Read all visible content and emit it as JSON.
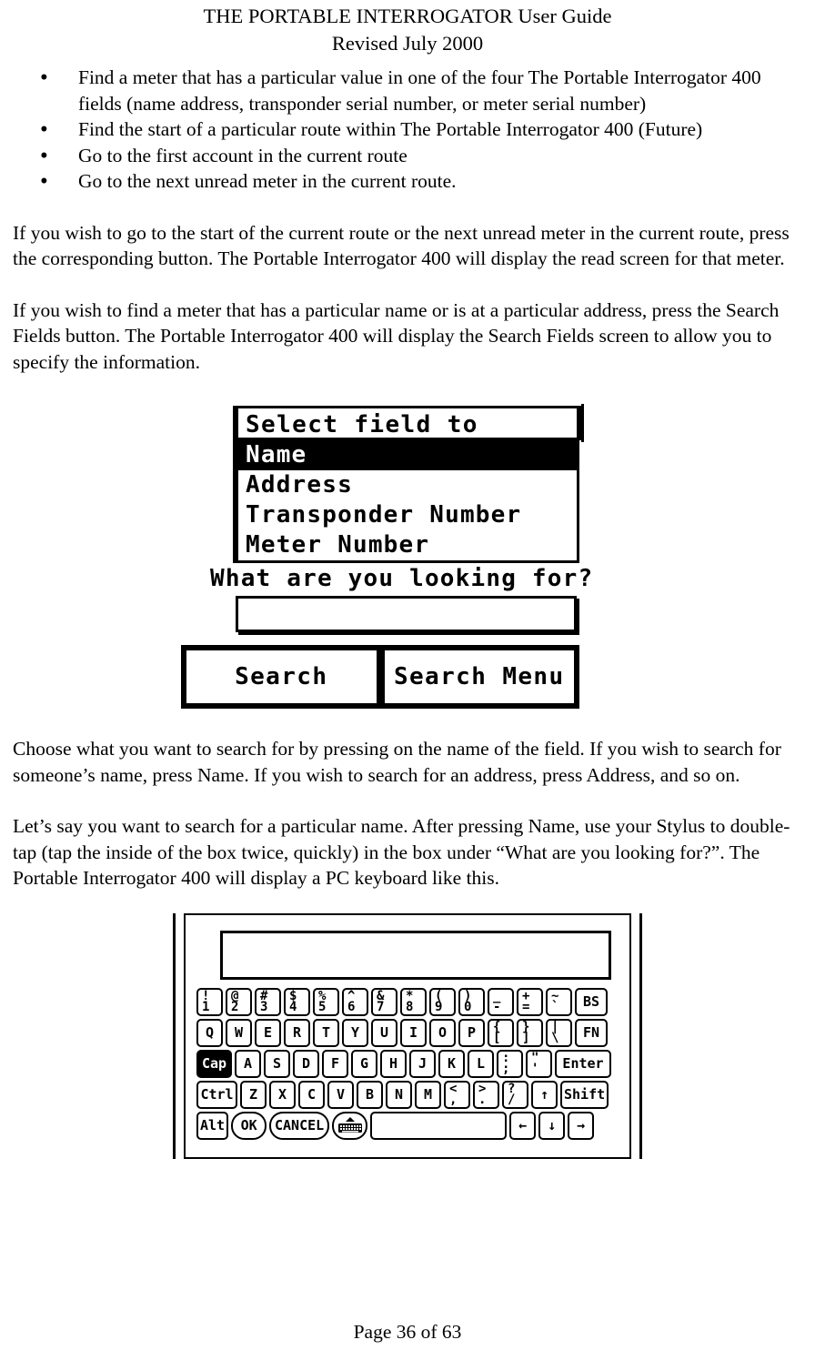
{
  "header": {
    "title": "THE PORTABLE INTERROGATOR User Guide",
    "revised": "Revised July 2000"
  },
  "bullets": [
    "Find a meter that has a particular value in one of the four The Portable Interrogator 400 fields (name address, transponder serial number, or meter serial number)",
    "Find the start of a particular route within The Portable Interrogator 400 (Future)",
    "Go to the first account in the current route",
    "Go to the next unread meter in the current route."
  ],
  "paragraphs": {
    "p1": "If you wish to go to the start of the current route or the next unread meter in the current route, press the corresponding button.  The Portable Interrogator 400 will display the read screen for that meter.",
    "p2": "If you wish to find a meter that has a particular name or is at a particular address, press the Search Fields button.  The Portable Interrogator 400 will display the Search Fields screen to allow you to specify the information.",
    "p3": "Choose what you want to search for by pressing on the name of the field.  If you wish to search for someone’s name, press Name.  If you wish to search for an address, press Address, and so on.",
    "p4": "Let’s say you want to search for a particular name.  After pressing Name, use your Stylus to double-tap (tap the inside of the box twice, quickly) in the box under “What are you looking for?”.  The Portable Interrogator 400 will display a PC keyboard like this."
  },
  "search_screen": {
    "title": "Select field to search",
    "fields": [
      {
        "label": "Name",
        "selected": true
      },
      {
        "label": "Address",
        "selected": false
      },
      {
        "label": "Transponder Number",
        "selected": false
      },
      {
        "label": "Meter Number",
        "selected": false
      }
    ],
    "prompt": "What are you looking for?",
    "input_value": "",
    "buttons": [
      {
        "label": "Search"
      },
      {
        "label": "Search Menu"
      }
    ]
  },
  "keyboard_screen": {
    "display_value": "",
    "rows": [
      {
        "keys": [
          {
            "type": "dual",
            "top": "!",
            "bottom": "1"
          },
          {
            "type": "dual",
            "top": "@",
            "bottom": "2"
          },
          {
            "type": "dual",
            "top": "#",
            "bottom": "3"
          },
          {
            "type": "dual",
            "top": "$",
            "bottom": "4"
          },
          {
            "type": "dual",
            "top": "%",
            "bottom": "5"
          },
          {
            "type": "dual",
            "top": "^",
            "bottom": "6"
          },
          {
            "type": "dual",
            "top": "&",
            "bottom": "7"
          },
          {
            "type": "dual",
            "top": "*",
            "bottom": "8"
          },
          {
            "type": "dual",
            "top": "(",
            "bottom": "9"
          },
          {
            "type": "dual",
            "top": ")",
            "bottom": "0"
          },
          {
            "type": "dual",
            "top": "_",
            "bottom": "-"
          },
          {
            "type": "dual",
            "top": "+",
            "bottom": "="
          },
          {
            "type": "dual",
            "top": "~",
            "bottom": "`"
          },
          {
            "type": "single",
            "label": "BS",
            "size": "wide-bs"
          }
        ]
      },
      {
        "keys": [
          {
            "type": "single",
            "label": "Q"
          },
          {
            "type": "single",
            "label": "W"
          },
          {
            "type": "single",
            "label": "E"
          },
          {
            "type": "single",
            "label": "R"
          },
          {
            "type": "single",
            "label": "T"
          },
          {
            "type": "single",
            "label": "Y"
          },
          {
            "type": "single",
            "label": "U"
          },
          {
            "type": "single",
            "label": "I"
          },
          {
            "type": "single",
            "label": "O"
          },
          {
            "type": "single",
            "label": "P"
          },
          {
            "type": "dual",
            "top": "{",
            "bottom": "["
          },
          {
            "type": "dual",
            "top": "}",
            "bottom": "]"
          },
          {
            "type": "dual",
            "top": "|",
            "bottom": "\\"
          },
          {
            "type": "single",
            "label": "FN",
            "size": "wide-fn"
          }
        ]
      },
      {
        "keys": [
          {
            "type": "single",
            "label": "Cap",
            "size": "wide-cap",
            "inverted": true
          },
          {
            "type": "single",
            "label": "A"
          },
          {
            "type": "single",
            "label": "S"
          },
          {
            "type": "single",
            "label": "D"
          },
          {
            "type": "single",
            "label": "F"
          },
          {
            "type": "single",
            "label": "G"
          },
          {
            "type": "single",
            "label": "H"
          },
          {
            "type": "single",
            "label": "J"
          },
          {
            "type": "single",
            "label": "K"
          },
          {
            "type": "single",
            "label": "L"
          },
          {
            "type": "dual",
            "top": ":",
            "bottom": ";"
          },
          {
            "type": "dual",
            "top": "\"",
            "bottom": "'"
          },
          {
            "type": "single",
            "label": "Enter",
            "size": "wide-enter"
          }
        ]
      },
      {
        "keys": [
          {
            "type": "single",
            "label": "Ctrl",
            "size": "wide-ctrl"
          },
          {
            "type": "single",
            "label": "Z"
          },
          {
            "type": "single",
            "label": "X"
          },
          {
            "type": "single",
            "label": "C"
          },
          {
            "type": "single",
            "label": "V"
          },
          {
            "type": "single",
            "label": "B"
          },
          {
            "type": "single",
            "label": "N"
          },
          {
            "type": "single",
            "label": "M"
          },
          {
            "type": "dual",
            "top": "<",
            "bottom": ","
          },
          {
            "type": "dual",
            "top": ">",
            "bottom": "."
          },
          {
            "type": "dual",
            "top": "?",
            "bottom": "/"
          },
          {
            "type": "single",
            "label": "↑"
          },
          {
            "type": "single",
            "label": "Shift",
            "size": "wide-shift"
          }
        ]
      },
      {
        "keys": [
          {
            "type": "single",
            "label": "Alt",
            "size": "wide-alt"
          },
          {
            "type": "single",
            "label": "OK",
            "size": "wide-ok",
            "rounded": true
          },
          {
            "type": "single",
            "label": "CANCEL",
            "size": "wide-cancel",
            "rounded": true
          },
          {
            "type": "icon",
            "icon": "keyboard-icon",
            "size": "kbd-icon-key",
            "rounded": true
          },
          {
            "type": "space",
            "label": "",
            "size": "spacebar"
          },
          {
            "type": "single",
            "label": "←"
          },
          {
            "type": "single",
            "label": "↓"
          },
          {
            "type": "single",
            "label": "→"
          }
        ]
      }
    ]
  },
  "footer": {
    "page_label": "Page 36 of 63"
  },
  "colors": {
    "ink": "#000000",
    "paper": "#ffffff"
  }
}
